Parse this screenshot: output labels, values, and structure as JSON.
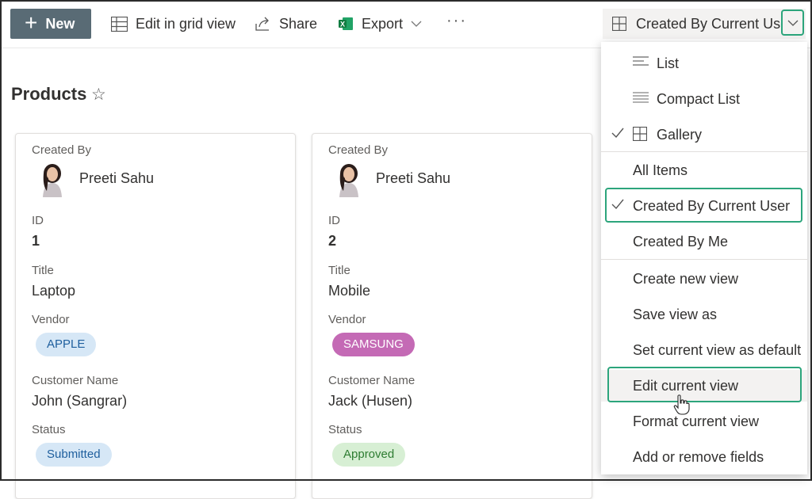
{
  "toolbar": {
    "new_label": "New",
    "grid_label": "Edit in grid view",
    "share_label": "Share",
    "export_label": "Export",
    "more_label": "···",
    "view_selector_label": "Created By Current User"
  },
  "page": {
    "title": "Products"
  },
  "cards": [
    {
      "created_by_label": "Created By",
      "created_by": "Preeti Sahu",
      "id_label": "ID",
      "id": "1",
      "title_label": "Title",
      "title": "Laptop",
      "vendor_label": "Vendor",
      "vendor": "APPLE",
      "customer_label": "Customer Name",
      "customer": "John (Sangrar)",
      "status_label": "Status",
      "status": "Submitted"
    },
    {
      "created_by_label": "Created By",
      "created_by": "Preeti Sahu",
      "id_label": "ID",
      "id": "2",
      "title_label": "Title",
      "title": "Mobile",
      "vendor_label": "Vendor",
      "vendor": "SAMSUNG",
      "customer_label": "Customer Name",
      "customer": "Jack (Husen)",
      "status_label": "Status",
      "status": "Approved"
    }
  ],
  "menu": {
    "layouts": [
      "List",
      "Compact List",
      "Gallery"
    ],
    "views": [
      "All Items",
      "Created By Current User",
      "Created By Me"
    ],
    "actions": [
      "Create new view",
      "Save view as",
      "Set current view as default",
      "Edit current view",
      "Format current view",
      "Add or remove fields"
    ]
  },
  "colors": {
    "new_button": "#596b75",
    "highlight": "#2ca57c",
    "apple_pill": "#d6e7f6",
    "samsung_pill": "#c46ab5",
    "submitted_pill": "#d6e7f6",
    "approved_pill": "#d7efd4"
  }
}
